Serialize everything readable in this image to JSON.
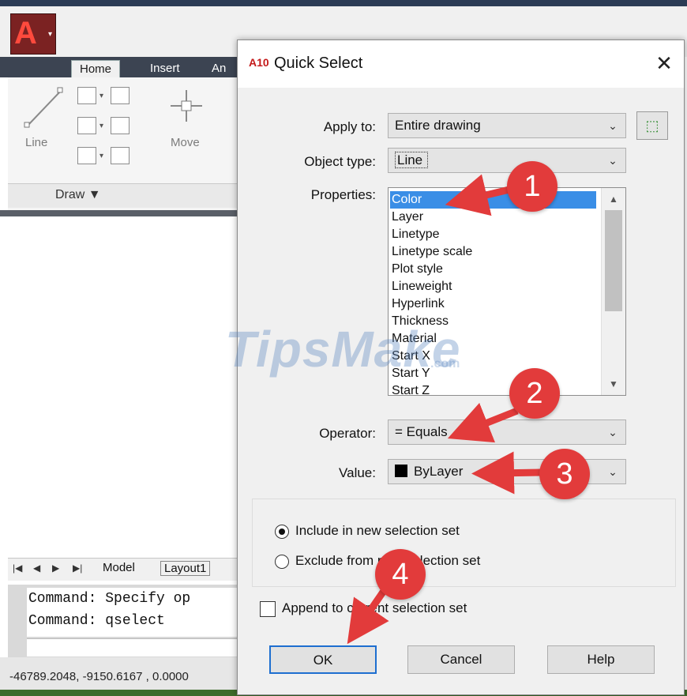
{
  "app": {
    "tabs": [
      "Home",
      "Insert",
      "An"
    ],
    "draw_panel_label": "Draw ▼",
    "line_tool_label": "Line",
    "move_tool_label": "Move",
    "layout_tabs": {
      "model": "Model",
      "layout1": "Layout1"
    },
    "command_lines": [
      "Command: Specify op",
      "Command: qselect"
    ],
    "status_coords": "-46789.2048, -9150.6167 , 0.0000"
  },
  "dialog": {
    "title": "Quick Select",
    "icon_text": "A10",
    "apply_to": {
      "label": "Apply to:",
      "value": "Entire drawing"
    },
    "object_type": {
      "label": "Object type:",
      "value": "Line"
    },
    "properties": {
      "label": "Properties:",
      "items": [
        "Color",
        "Layer",
        "Linetype",
        "Linetype scale",
        "Plot style",
        "Lineweight",
        "Hyperlink",
        "Thickness",
        "Material",
        "Start X",
        "Start Y",
        "Start Z"
      ],
      "selected": "Color"
    },
    "operator": {
      "label": "Operator:",
      "value": "= Equals"
    },
    "value": {
      "label": "Value:",
      "value": "ByLayer",
      "swatch_color": "#000000"
    },
    "how_to_apply": {
      "include_label": "Include in new selection set",
      "exclude_label": "Exclude from new selection set",
      "selected": "include"
    },
    "append_label": "Append to current selection set",
    "append_checked": false,
    "buttons": {
      "ok": "OK",
      "cancel": "Cancel",
      "help": "Help"
    }
  },
  "annotations": {
    "badges": [
      "1",
      "2",
      "3",
      "4"
    ],
    "badge_color": "#e23b3b"
  },
  "watermark": {
    "text": "TipsMake",
    "suffix": ".com"
  }
}
